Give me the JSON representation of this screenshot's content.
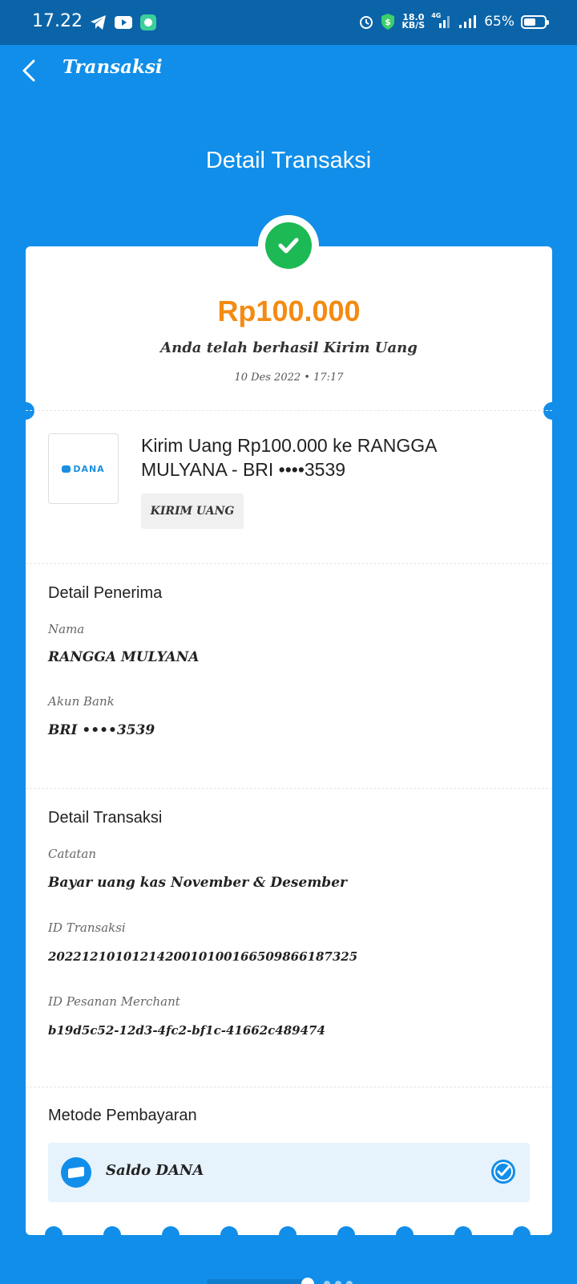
{
  "status_bar": {
    "time": "17.22",
    "net_speed_value": "18.0",
    "net_speed_unit": "KB/S",
    "network": "4G",
    "battery": "65%",
    "battery_level": 0.65,
    "icons": [
      "telegram-icon",
      "youtube-icon",
      "chat-icon",
      "alarm-icon",
      "shield-dollar-icon",
      "signal-icon",
      "signal-icon",
      "battery-icon"
    ]
  },
  "app_bar": {
    "title": "Transaksi",
    "back_icon": "chevron-left-icon"
  },
  "page_heading": "Detail Transaksi",
  "summary": {
    "amount": "Rp100.000",
    "message": "Anda telah berhasil Kirim Uang",
    "date": "10 Des 2022 • 17:17",
    "status_icon": "check-circle-icon"
  },
  "transaction": {
    "logo_text": "DANA",
    "description": "Kirim Uang Rp100.000 ke RANGGA MULYANA - BRI ••••3539",
    "tag": "KIRIM UANG"
  },
  "recipient": {
    "title": "Detail Penerima",
    "name_label": "Nama",
    "name_value": "RANGGA MULYANA",
    "bank_label": "Akun Bank",
    "bank_value": "BRI ••••3539"
  },
  "details": {
    "title": "Detail Transaksi",
    "note_label": "Catatan",
    "note_value": "Bayar uang kas November & Desember",
    "tx_id_label": "ID Transaksi",
    "tx_id_value": "2022121010121420010100166509866187325",
    "merchant_id_label": "ID Pesanan Merchant",
    "merchant_id_value": "b19d5c52-12d3-4fc2-bf1c-41662c489474"
  },
  "payment": {
    "title": "Metode Pembayaran",
    "method": "Saldo DANA",
    "method_icon": "wallet-icon",
    "selected_icon": "check-badge-icon"
  },
  "colors": {
    "background": "#118ee9",
    "status_bar": "#0b64a8",
    "amount": "#f38b12",
    "success": "#1db954",
    "payment_box": "#e6f2fc"
  }
}
